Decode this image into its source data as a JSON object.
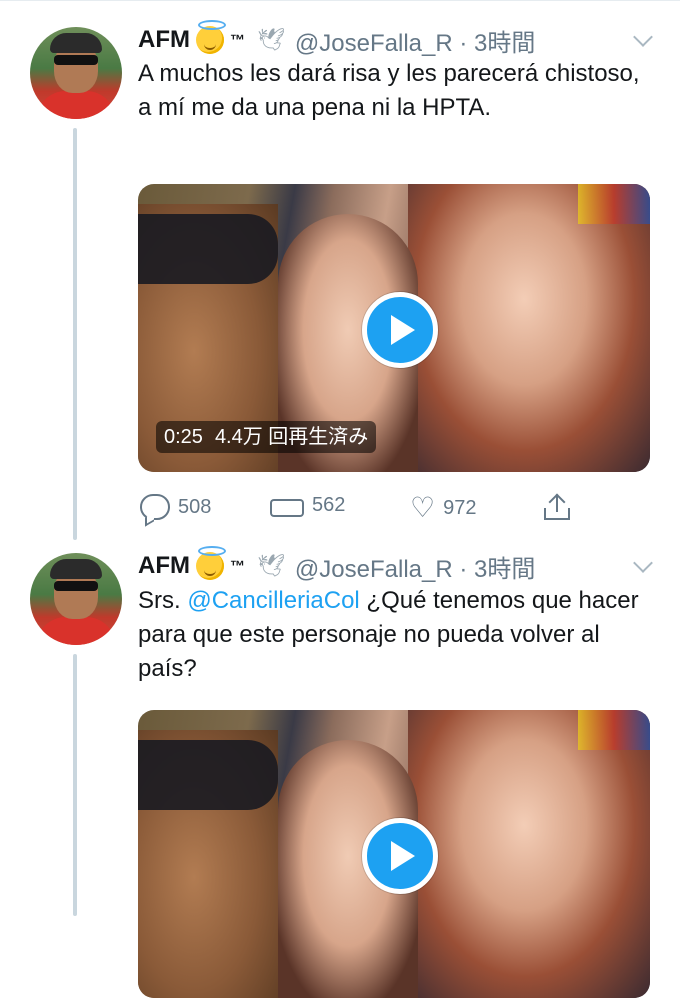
{
  "tweets": [
    {
      "author": {
        "name": "AFM",
        "tm": "™",
        "apple": "",
        "dove": "🕊",
        "handle": "@JoseFalla_R",
        "time": "3時間"
      },
      "text_parts": [
        "A muchos les dará risa y les parecerá chistoso, a mí me da una pena ni la HPTA."
      ],
      "media": {
        "duration": "0:25",
        "views": "4.4万 回再生済み"
      },
      "actions": {
        "replies": "508",
        "retweets": "562",
        "likes": "972"
      }
    },
    {
      "author": {
        "name": "AFM",
        "tm": "™",
        "apple": "",
        "dove": "🕊",
        "handle": "@JoseFalla_R",
        "time": "3時間"
      },
      "text_prefix": "Srs. ",
      "mention": "@CancilleriaCol",
      "text_suffix": " ¿Qué tenemos que hacer para que este personaje no pueda volver al país?"
    }
  ],
  "meta": {
    "separator": " · "
  },
  "colors": {
    "link": "#1da1f2",
    "secondary": "#657786",
    "thread": "#c9d6de"
  }
}
